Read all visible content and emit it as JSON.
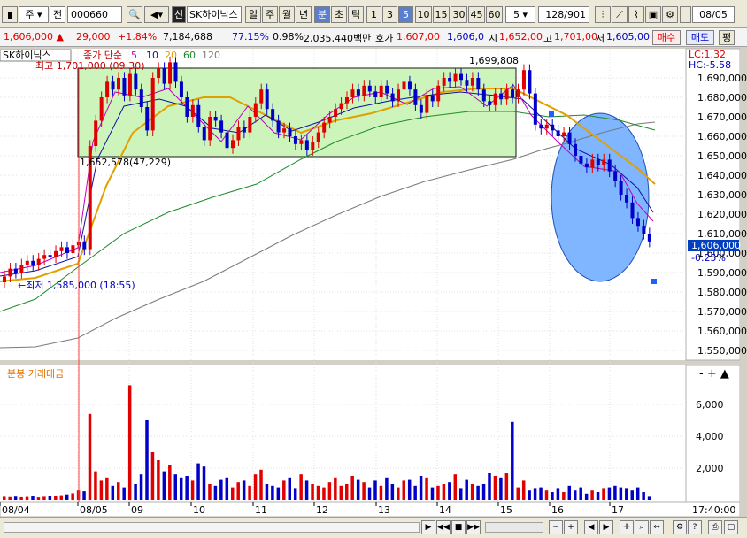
{
  "toolbar": {
    "market": "주",
    "prefix": "전",
    "code": "000660",
    "logo_char": "신",
    "name": "SK하이닉스",
    "periods": [
      "일",
      "주",
      "월",
      "년",
      "분",
      "초",
      "틱"
    ],
    "selected_period": "분",
    "intervals": [
      "1",
      "3",
      "5",
      "10",
      "15",
      "30",
      "45",
      "60"
    ],
    "selected_interval": "5",
    "interval_select": "5",
    "count": "128",
    "total": "/901",
    "date_value": "08/05"
  },
  "quote": {
    "price": "1,606,000",
    "change": "29,000",
    "change_pct": "+1.84%",
    "volume": "7,184,688",
    "ratio": "77.15%",
    "turnover_pct": "0.98%",
    "amount": "2,035,440백만",
    "bid_label": "호가",
    "bid_prices": "1,607,00",
    "bid_prices2": "1,606,0",
    "open_label": "시",
    "open": "1,652,00",
    "high_label": "고",
    "high": "1,701,00",
    "low_label": "저",
    "low": "1,605,00",
    "buy_label": "매수",
    "sell_label": "매도",
    "avg_label": "평"
  },
  "legend": {
    "stock": "SK하이닉스",
    "ma_label": "종가 단순",
    "ma_periods": [
      "5",
      "10",
      "20",
      "60",
      "120"
    ],
    "high_note": "최고 1,701,000 (09:30)",
    "low_note": "최저 1,585,000 (18:55)",
    "box_top_value": "1,699,808",
    "box_bottom_value": "1,652,578(47,229)",
    "lc": "LC:1.32",
    "hc": "HC:-5.58",
    "current_price": "1,606,000",
    "current_pct": "-0.25%",
    "volume_label": "분봉 거래대금"
  },
  "axis": {
    "price_ticks": [
      "1,690,000",
      "1,680,000",
      "1,670,000",
      "1,660,000",
      "1,650,000",
      "1,640,000",
      "1,630,000",
      "1,620,000",
      "1,610,000",
      "1,600,000",
      "1,590,000",
      "1,580,000",
      "1,570,000",
      "1,560,000",
      "1,550,000"
    ],
    "vol_ticks": [
      "6,000",
      "4,000",
      "2,000"
    ],
    "date_labels": [
      "08/04",
      "08/05",
      "09",
      "10",
      "11",
      "12",
      "13",
      "14",
      "15",
      "16",
      "17"
    ],
    "time_label": "17:40:00"
  },
  "chart_data": {
    "type": "candlestick",
    "ylim": [
      1545000,
      1705000
    ],
    "closes": [
      1588000,
      1592000,
      1590000,
      1594000,
      1596000,
      1594000,
      1597000,
      1599000,
      1598000,
      1601000,
      1603000,
      1600000,
      1604000,
      1606000,
      1602000,
      1655000,
      1668000,
      1680000,
      1688000,
      1684000,
      1690000,
      1681000,
      1692000,
      1684000,
      1675000,
      1663000,
      1690000,
      1695000,
      1687000,
      1698000,
      1688000,
      1680000,
      1670000,
      1676000,
      1665000,
      1658000,
      1670000,
      1668000,
      1662000,
      1654000,
      1658000,
      1665000,
      1662000,
      1670000,
      1677000,
      1684000,
      1674000,
      1668000,
      1662000,
      1664000,
      1660000,
      1656000,
      1658000,
      1653000,
      1657000,
      1662000,
      1667000,
      1670000,
      1674000,
      1677000,
      1680000,
      1684000,
      1681000,
      1686000,
      1683000,
      1680000,
      1686000,
      1682000,
      1678000,
      1684000,
      1688000,
      1684000,
      1676000,
      1672000,
      1681000,
      1678000,
      1686000,
      1690000,
      1688000,
      1692000,
      1689000,
      1686000,
      1690000,
      1684000,
      1678000,
      1676000,
      1682000,
      1679000,
      1684000,
      1680000,
      1684000,
      1694000,
      1682000,
      1666000,
      1664000,
      1666000,
      1663000,
      1660000,
      1662000,
      1656000,
      1650000,
      1646000,
      1644000,
      1648000,
      1645000,
      1648000,
      1642000,
      1637000,
      1630000,
      1626000,
      1618000,
      1614000,
      1610000,
      1606000
    ],
    "volume": [
      200,
      180,
      210,
      170,
      190,
      220,
      160,
      200,
      240,
      230,
      300,
      350,
      420,
      600,
      550,
      5400,
      1800,
      1200,
      1400,
      900,
      1100,
      800,
      7200,
      1000,
      1600,
      5000,
      3000,
      2500,
      1800,
      2200,
      1600,
      1400,
      1500,
      1200,
      2300,
      2100,
      1000,
      900,
      1300,
      1400,
      800,
      1100,
      1200,
      900,
      1600,
      1900,
      1000,
      900,
      800,
      1200,
      1400,
      700,
      1600,
      1200,
      1000,
      900,
      800,
      1100,
      1400,
      900,
      1000,
      1500,
      1300,
      1100,
      800,
      1200,
      900,
      1400,
      1000,
      800,
      1200,
      1300,
      900,
      1500,
      1400,
      800,
      900,
      1000,
      1100,
      1600,
      700,
      1300,
      1000,
      900,
      1000,
      1700,
      1500,
      1400,
      1700,
      4900,
      800,
      1200,
      600,
      700,
      800,
      600,
      500,
      700,
      500,
      900,
      600,
      800,
      400,
      600,
      500,
      700,
      800,
      900,
      800,
      700,
      600,
      800,
      500,
      200
    ]
  },
  "colors": {
    "up": "#e00000",
    "down": "#0000c8",
    "box_fill": "#c8f5b4",
    "ellipse_fill": "#6aa8ff"
  }
}
